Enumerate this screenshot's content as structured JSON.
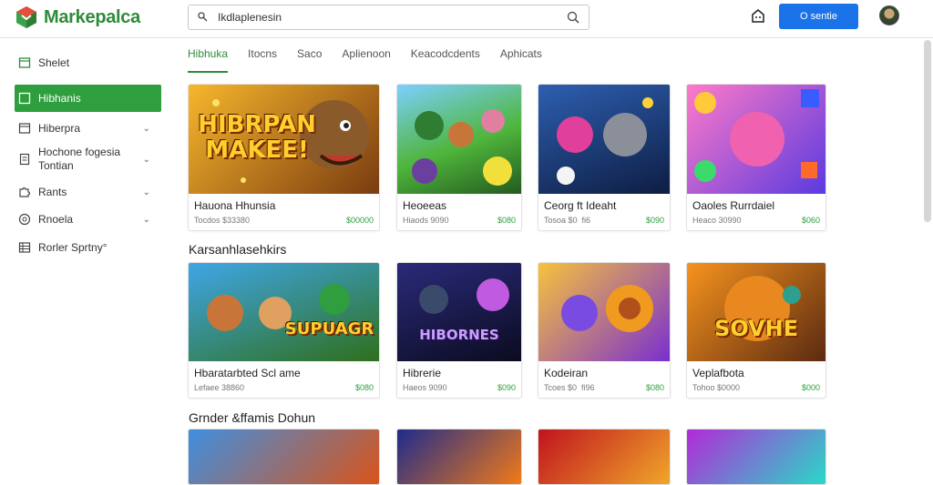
{
  "app": {
    "logo_text": "Markepalca"
  },
  "search": {
    "value": "Ikdlaplenesin"
  },
  "header": {
    "signin_label": "O sentie"
  },
  "sidebar": {
    "items": [
      {
        "label": "Shelet",
        "icon": "store-icon",
        "chevron": false
      },
      {
        "label": "Hibhanis",
        "icon": "grid-icon",
        "chevron": false,
        "active": true
      },
      {
        "label": "Hiberpra",
        "icon": "category-icon",
        "chevron": true
      },
      {
        "label": "Hochone fogesia",
        "label2": "Tontian",
        "icon": "document-icon",
        "chevron": true
      },
      {
        "label": "Rants",
        "icon": "puzzle-icon",
        "chevron": true
      },
      {
        "label": "Rnoela",
        "icon": "globe-icon",
        "chevron": true
      },
      {
        "label": "Rorler Sprtny°",
        "icon": "table-icon",
        "chevron": false
      }
    ]
  },
  "tabs": [
    {
      "label": "Hibhuka",
      "active": true
    },
    {
      "label": "Itocns"
    },
    {
      "label": "Saco"
    },
    {
      "label": "Aplienoon"
    },
    {
      "label": "Keacodcdents"
    },
    {
      "label": "Aphicats"
    }
  ],
  "sections": [
    {
      "title": ""
    },
    {
      "title": "Karsanhlasehkirs"
    },
    {
      "title": "Grnder &ffamis Dohun"
    }
  ],
  "cards_row1": [
    {
      "title": "Hauona Hhunsia",
      "meta": "Tocdos $33380",
      "price": "$00000",
      "art_text": "HIBRPAN MAKEE!",
      "bg": [
        "#f7b72c",
        "#7a3b10"
      ]
    },
    {
      "title": "Heoeeas",
      "meta": "Hiaods 9090",
      "price": "$080",
      "art_text": "",
      "bg": [
        "#4fb53b",
        "#245a1f"
      ]
    },
    {
      "title": "Ceorg ft Ideaht",
      "meta": "Tosoa $0  fi6",
      "price": "$090",
      "art_text": "",
      "bg": [
        "#2d5fb0",
        "#0e1d43"
      ]
    },
    {
      "title": "Oaoles Rurrdaiel",
      "meta": "Heaco 30990",
      "price": "$060",
      "art_text": "",
      "bg": [
        "#ff7ac8",
        "#5a3ae0"
      ]
    }
  ],
  "cards_row2": [
    {
      "title": "Hbaratarbted Scl ame",
      "meta": "Lefaee 38860",
      "price": "$080",
      "art_text": "SUPUAGR",
      "bg": [
        "#3fa6e6",
        "#2f6f1c"
      ]
    },
    {
      "title": "Hibrerie",
      "meta": "Haeos 9090",
      "price": "$090",
      "art_text": "HIBORNES",
      "bg": [
        "#2a2a7a",
        "#0b0b20"
      ]
    },
    {
      "title": "Kodeiran",
      "meta": "Tcoes $0  fi96",
      "price": "$080",
      "art_text": "",
      "bg": [
        "#f7c23b",
        "#7a2fd0"
      ]
    },
    {
      "title": "Veplafbota",
      "meta": "Tohoo $0000",
      "price": "$000",
      "art_text": "SOVHE",
      "bg": [
        "#f7931e",
        "#5a2a10"
      ]
    }
  ],
  "cards_row3": [
    {
      "bg": [
        "#3f8fe0",
        "#d9541a"
      ]
    },
    {
      "bg": [
        "#1f2b8c",
        "#f07a18"
      ]
    },
    {
      "bg": [
        "#c0131d",
        "#f0a62a"
      ]
    },
    {
      "bg": [
        "#b22ad8",
        "#2ad8c8"
      ]
    }
  ],
  "colors": {
    "accent_green": "#2e9e3e",
    "brand_green": "#2e8b3a",
    "signin_blue": "#1a73e8"
  }
}
